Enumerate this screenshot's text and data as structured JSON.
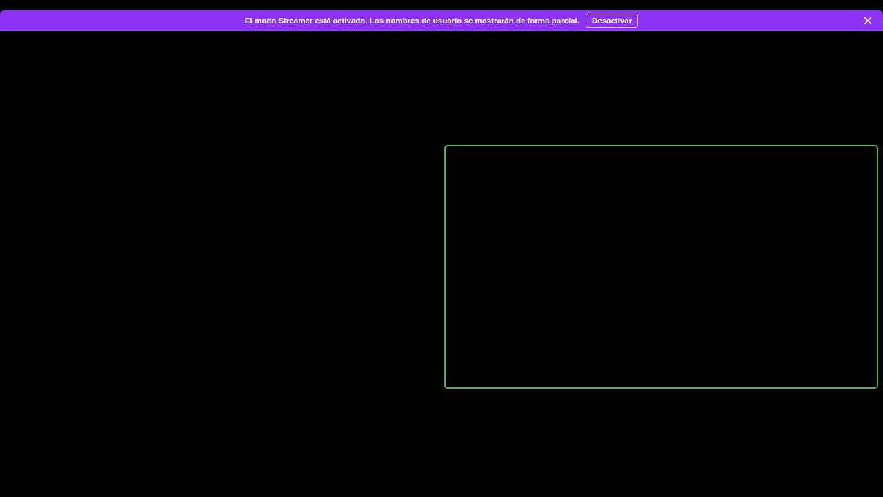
{
  "banner": {
    "message": "El modo Streamer está activado. Los nombres de usuario se mostrarán de forma parcial.",
    "button": "Desactivar"
  }
}
